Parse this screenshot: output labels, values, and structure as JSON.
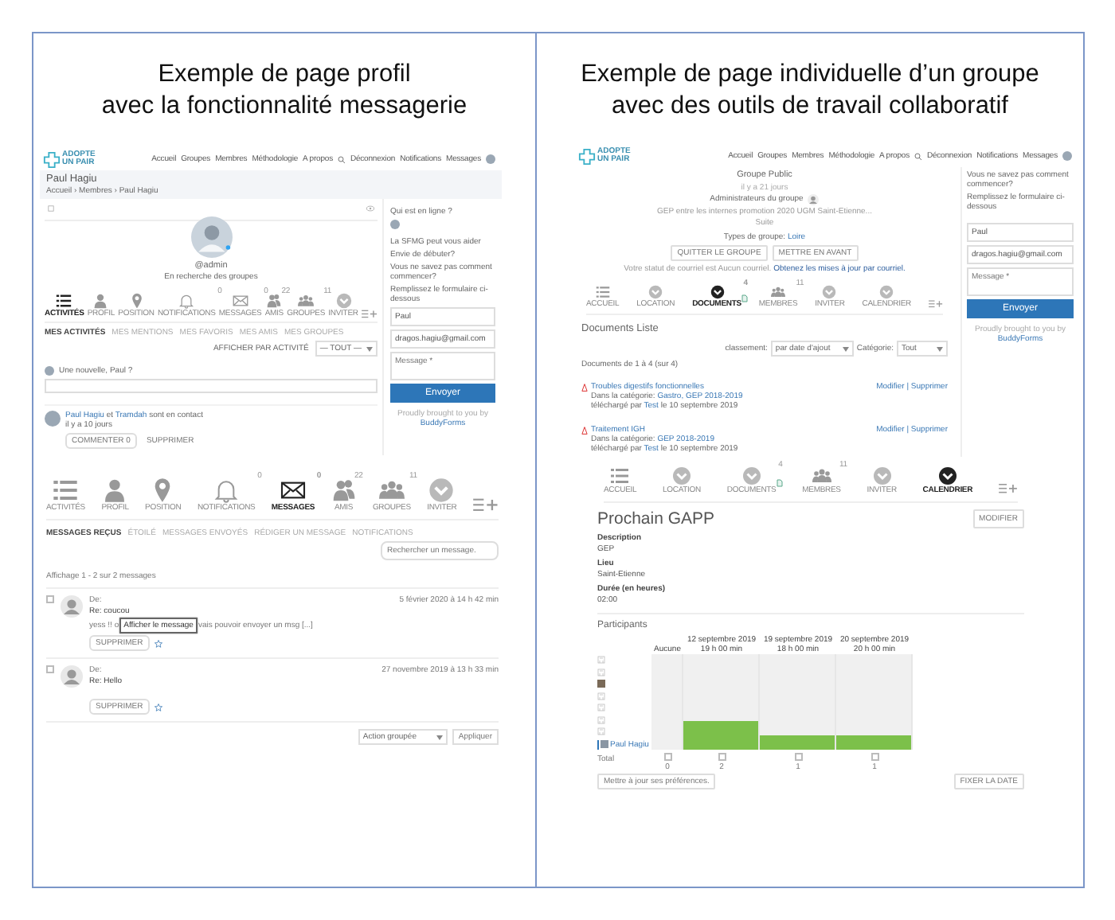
{
  "left": {
    "title_lines": [
      "Exemple de page profil",
      "avec la fonctionnalité messagerie"
    ],
    "profile": {
      "header": {
        "logo": [
          "ADOPTE",
          "UN PAIR"
        ],
        "nav": [
          "Accueil",
          "Groupes",
          "Membres",
          "Méthodologie",
          "A propos"
        ],
        "nav_right": [
          "Déconnexion",
          "Notifications",
          "Messages"
        ]
      },
      "page_title": "Paul Hagiu",
      "breadcrumb": "Accueil › Membres › Paul Hagiu",
      "username": "@admin",
      "status": "En recherche des groupes",
      "icon_nav": [
        {
          "label": "ACTIVITÉS",
          "kind": "list",
          "selected": true
        },
        {
          "label": "PROFIL",
          "kind": "person",
          "selected": false
        },
        {
          "label": "POSITION",
          "kind": "pin",
          "selected": false
        },
        {
          "label": "NOTIFICATIONS",
          "kind": "bell",
          "badge": "0",
          "selected": false
        },
        {
          "label": "MESSAGES",
          "kind": "mail",
          "badge": "0",
          "selected": false
        },
        {
          "label": "AMIS",
          "kind": "friends",
          "badge": "22",
          "selected": false
        },
        {
          "label": "GROUPES",
          "kind": "groups",
          "badge": "11",
          "selected": false
        },
        {
          "label": "INVITER",
          "kind": "chevron",
          "selected": false
        }
      ],
      "subtabs": [
        {
          "label": "MES ACTIVITÉS",
          "selected": true
        },
        {
          "label": "MES MENTIONS",
          "selected": false
        },
        {
          "label": "MES FAVORIS",
          "selected": false
        },
        {
          "label": "MES AMIS",
          "selected": false
        },
        {
          "label": "MES GROUPES",
          "selected": false
        }
      ],
      "filter_label": "AFFICHER PAR ACTIVITÉ",
      "filter_value": "— TOUT —",
      "post_prompt": "Une nouvelle, Paul ?",
      "activity": {
        "user": "Paul Hagiu",
        "joiner": "et",
        "friend": "Tramdah",
        "action": "sont en contact",
        "time": "il y a 10 jours",
        "comment": "COMMENTER",
        "comment_count": "0",
        "delete": "SUPPRIMER"
      },
      "sidebar": {
        "online_title": "Qui est en ligne ?",
        "help_title": "La SFMG peut vous aider",
        "help_lines": [
          "Envie de débuter?",
          "Vous ne savez pas comment commencer?",
          "Remplissez le formulaire ci-dessous"
        ],
        "fields": [
          {
            "value": "Paul"
          },
          {
            "value": "dragos.hagiu@gmail.com"
          },
          {
            "placeholder": "Message *",
            "kind": "textarea"
          }
        ],
        "submit": "Envoyer",
        "credit": "Proudly brought to you by",
        "credit_link": "BuddyForms"
      }
    },
    "messages": {
      "icon_nav": [
        {
          "label": "ACTIVITÉS",
          "kind": "list",
          "selected": false
        },
        {
          "label": "PROFIL",
          "kind": "person",
          "selected": false
        },
        {
          "label": "POSITION",
          "kind": "pin",
          "selected": false
        },
        {
          "label": "NOTIFICATIONS",
          "kind": "bell",
          "badge": "0",
          "selected": false
        },
        {
          "label": "MESSAGES",
          "kind": "mail",
          "badge": "0",
          "selected": true
        },
        {
          "label": "AMIS",
          "kind": "friends",
          "badge": "22",
          "selected": false
        },
        {
          "label": "GROUPES",
          "kind": "groups",
          "badge": "11",
          "selected": false
        },
        {
          "label": "INVITER",
          "kind": "chevron",
          "selected": false
        }
      ],
      "subtabs": [
        {
          "label": "MESSAGES REÇUS",
          "selected": true
        },
        {
          "label": "ÉTOILÉ",
          "selected": false
        },
        {
          "label": "MESSAGES ENVOYÉS",
          "selected": false
        },
        {
          "label": "RÉDIGER UN MESSAGE",
          "selected": false
        },
        {
          "label": "NOTIFICATIONS",
          "selected": false
        }
      ],
      "search": {
        "placeholder": "Rechercher un message."
      },
      "count": "Affichage 1 - 2 sur 2 messages",
      "items": [
        {
          "from": "De:",
          "subject": "Re: coucou",
          "excerpt_parts": [
            "yess !! o",
            "vais pouvoir envoyer un msg [...]"
          ],
          "tooltip": "Afficher le message",
          "date": "5 février 2020 à 14 h 42 min",
          "delete": "SUPPRIMER",
          "checked": false,
          "starred": false
        },
        {
          "from": "De:",
          "subject": "Re: Hello",
          "date": "27 novembre 2019 à 13 h 33 min",
          "delete": "SUPPRIMER",
          "checked": false,
          "starred": false
        }
      ],
      "bulk_action": "Action groupée",
      "apply": "Appliquer"
    }
  },
  "right": {
    "title_lines": [
      "Exemple de page individuelle d’un groupe",
      "avec des outils de travail collaboratif"
    ],
    "group": {
      "header": {
        "logo": [
          "ADOPTE",
          "UN PAIR"
        ],
        "nav": [
          "Accueil",
          "Groupes",
          "Membres",
          "Méthodologie",
          "A propos"
        ],
        "nav_right": [
          "Déconnexion",
          "Notifications",
          "Messages"
        ]
      },
      "group_type": "Groupe Public",
      "age": "il y a 21 jours",
      "admins_label": "Administrateurs du groupe",
      "description": "GEP entre les internes promotion 2020 UGM Saint-Etienne...",
      "more": "Suite",
      "types_label": "Types de groupe:",
      "types_value": "Loire",
      "buttons": [
        "QUITTER LE GROUPE",
        "METTRE EN AVANT"
      ],
      "email_status": "Votre statut de courriel est Aucun courriel.",
      "email_link": "Obtenez les mises à jour par courriel.",
      "icon_nav": [
        {
          "label": "ACCUEIL",
          "kind": "list",
          "selected": false
        },
        {
          "label": "LOCATION",
          "kind": "chevron",
          "selected": false
        },
        {
          "label": "DOCUMENTS",
          "kind": "chevron",
          "badge": "4",
          "upload_icon": true,
          "selected": true
        },
        {
          "label": "MEMBRES",
          "kind": "groups",
          "badge": "11",
          "selected": false
        },
        {
          "label": "INVITER",
          "kind": "chevron",
          "selected": false
        },
        {
          "label": "CALENDRIER",
          "kind": "chevron",
          "selected": false
        }
      ],
      "docs_title": "Documents Liste",
      "sort_label": "classement:",
      "sort_value": "par date d'ajout",
      "category_label": "Catégorie:",
      "category_value": "Tout",
      "docs_count": "Documents de 1 à 4 (sur 4)",
      "documents": [
        {
          "title": "Troubles digestifs fonctionnelles",
          "in_label": "Dans la catégorie:",
          "categories": "Gastro, GEP 2018-2019",
          "by_label": "téléchargé par",
          "user": "Test",
          "date": "le 10 septembre 2019",
          "actions": "Modifier | Supprimer"
        },
        {
          "title": "Traitement IGH",
          "in_label": "Dans la catégorie:",
          "categories": "GEP 2018-2019",
          "by_label": "téléchargé par",
          "user": "Test",
          "date": "le 10 septembre 2019",
          "actions": "Modifier | Supprimer"
        }
      ],
      "sidebar": {
        "help_lines": [
          "Vous ne savez pas comment commencer?",
          "Remplissez le formulaire ci-dessous"
        ],
        "fields": [
          {
            "value": "Paul"
          },
          {
            "value": "dragos.hagiu@gmail.com"
          },
          {
            "placeholder": "Message *",
            "kind": "textarea"
          }
        ],
        "submit": "Envoyer",
        "credit": "Proudly brought to you by",
        "credit_link": "BuddyForms"
      }
    },
    "calendar": {
      "icon_nav": [
        {
          "label": "ACCUEIL",
          "kind": "list",
          "selected": false
        },
        {
          "label": "LOCATION",
          "kind": "chevron",
          "selected": false
        },
        {
          "label": "DOCUMENTS",
          "kind": "chevron",
          "badge": "4",
          "upload_icon": true,
          "selected": false
        },
        {
          "label": "MEMBRES",
          "kind": "groups",
          "badge": "11",
          "selected": false
        },
        {
          "label": "INVITER",
          "kind": "chevron",
          "selected": false
        },
        {
          "label": "CALENDRIER",
          "kind": "chevron",
          "selected": true
        }
      ],
      "title": "Prochain GAPP",
      "edit": "MODIFIER",
      "fields": [
        {
          "label": "Description",
          "value": "GEP"
        },
        {
          "label": "Lieu",
          "value": "Saint-Etienne"
        },
        {
          "label": "Durée (en heures)",
          "value": "02:00"
        }
      ],
      "participants_title": "Participants",
      "options": [
        {
          "date": "Aucune",
          "total": "0",
          "checked": false
        },
        {
          "date": "12 septembre 2019",
          "time": "19 h 00 min",
          "level": 0.3,
          "total": "2",
          "checked": false
        },
        {
          "date": "19 septembre 2019",
          "time": "18 h 00 min",
          "level": 0.15,
          "total": "1",
          "checked": false
        },
        {
          "date": "20 septembre 2019",
          "time": "20 h 00 min",
          "level": 0.15,
          "total": "1",
          "checked": false
        }
      ],
      "participants": [
        {
          "kind": "blank"
        },
        {
          "kind": "blank"
        },
        {
          "kind": "photo"
        },
        {
          "kind": "blank"
        },
        {
          "kind": "blank"
        },
        {
          "kind": "blank"
        },
        {
          "kind": "blank"
        },
        {
          "kind": "self",
          "name": "Paul Hagiu"
        }
      ],
      "total_label": "Total",
      "update": "Mettre à jour ses préférences.",
      "fix_date": "FIXER LA DATE"
    }
  }
}
